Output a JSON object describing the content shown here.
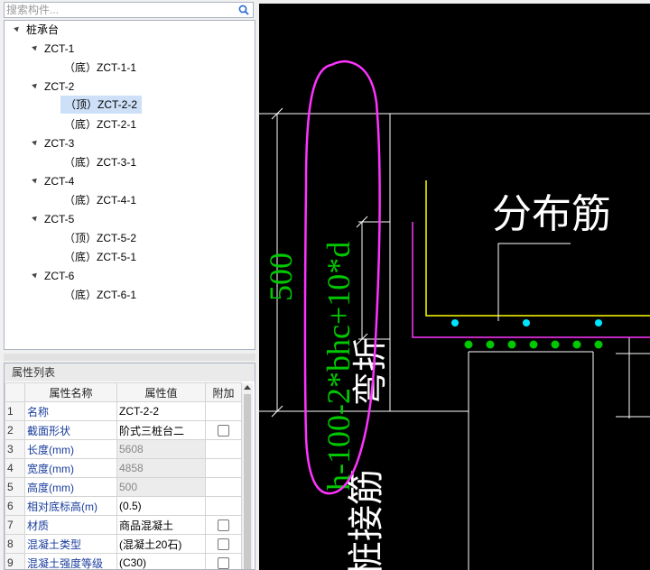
{
  "search": {
    "placeholder": "搜索构件..."
  },
  "tree": {
    "root": "桩承台",
    "groups": [
      {
        "label": "ZCT-1",
        "children": [
          "（底）ZCT-1-1"
        ]
      },
      {
        "label": "ZCT-2",
        "children": [
          "（顶）ZCT-2-2",
          "（底）ZCT-2-1"
        ]
      },
      {
        "label": "ZCT-3",
        "children": [
          "（底）ZCT-3-1"
        ]
      },
      {
        "label": "ZCT-4",
        "children": [
          "（底）ZCT-4-1"
        ]
      },
      {
        "label": "ZCT-5",
        "children": [
          "（顶）ZCT-5-2",
          "（底）ZCT-5-1"
        ]
      },
      {
        "label": "ZCT-6",
        "children": [
          "（底）ZCT-6-1"
        ]
      }
    ],
    "selected": "（顶）ZCT-2-2"
  },
  "properties": {
    "title": "属性列表",
    "headers": [
      "属性名称",
      "属性值",
      "附加"
    ],
    "rows": [
      {
        "num": "1",
        "name": "名称",
        "value": "ZCT-2-2"
      },
      {
        "num": "2",
        "name": "截面形状",
        "value": "阶式三桩台二"
      },
      {
        "num": "3",
        "name": "长度(mm)",
        "value": "5608"
      },
      {
        "num": "4",
        "name": "宽度(mm)",
        "value": "4858"
      },
      {
        "num": "5",
        "name": "高度(mm)",
        "value": "500"
      },
      {
        "num": "6",
        "name": "相对底标高(m)",
        "value": "(0.5)"
      },
      {
        "num": "7",
        "name": "材质",
        "value": "商品混凝土"
      },
      {
        "num": "8",
        "name": "混凝土类型",
        "value": "(混凝土20石)"
      },
      {
        "num": "9",
        "name": "混凝土强度等级",
        "value": "(C30)"
      }
    ]
  },
  "cad": {
    "dim_text": "500",
    "formula_text": "h-100-2*bhc+10*d",
    "dist_label": "分布筋",
    "bent_label": "弯折",
    "connect_label": "桩接筋",
    "colors": {
      "background": "#000000",
      "green": "#00c800",
      "yellow": "#ffff00",
      "magenta": "#ff33ff",
      "cyan": "#00e5ff",
      "white": "#ffffff"
    }
  }
}
